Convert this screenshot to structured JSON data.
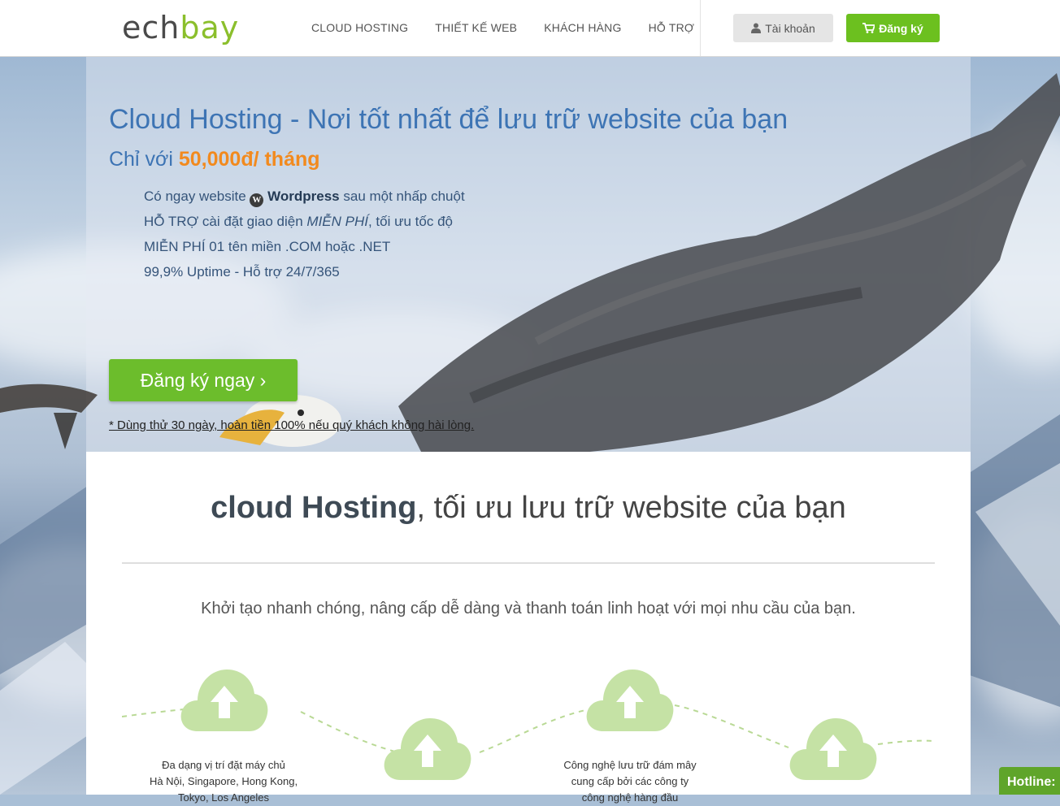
{
  "logo": {
    "part1": "ech",
    "part2": "bay"
  },
  "nav": {
    "items": [
      {
        "label": "CLOUD HOSTING"
      },
      {
        "label": "THIẾT KẾ WEB"
      },
      {
        "label": "KHÁCH HÀNG"
      },
      {
        "label": "HỖ TRỢ"
      }
    ]
  },
  "header_buttons": {
    "account": "Tài khoản",
    "signup": "Đăng ký"
  },
  "hero": {
    "title": "Cloud Hosting - Nơi tốt nhất để lưu trữ website của bạn",
    "subtitle_prefix": "Chỉ với ",
    "price": "50,000đ/ tháng",
    "features": {
      "f1_a": "Có ngay website ",
      "f1_b": "Wordpress",
      "f1_c": " sau một nhấp chuột",
      "f2_a": "HỖ TRỢ cài đặt giao diện ",
      "f2_b": "MIỄN PHÍ",
      "f2_c": ", tối ưu tốc độ",
      "f3": "MIỄN PHÍ 01 tên miền .COM hoặc .NET",
      "f4": "99,9% Uptime - Hỗ trợ 24/7/365"
    },
    "cta": "Đăng ký ngay ›",
    "trial_note": "* Dùng thử 30 ngày, hoàn tiền 100% nếu quý khách không hài lòng."
  },
  "section": {
    "title_bold": "cloud Hosting",
    "title_rest": ", tối ưu lưu trữ website của bạn",
    "lead": "Khởi tạo nhanh chóng, nâng cấp dễ dàng và thanh toán linh hoạt với mọi nhu cầu của bạn.",
    "feature1_line1": "Đa dạng vị trí đặt máy chủ",
    "feature1_line2": "Hà Nội, Singapore, Hong Kong,",
    "feature1_line3": "Tokyo, Los Angeles",
    "feature2_line1": "Công nghệ lưu trữ đám mây",
    "feature2_line2": "cung cấp bởi các công ty",
    "feature2_line3": "công nghệ hàng đầu"
  },
  "hotline": "Hotline:",
  "colors": {
    "brand_green": "#6cc01f",
    "brand_blue": "#3d74b4",
    "price_orange": "#f28a1e",
    "cloud_green": "#c5e2a5"
  }
}
